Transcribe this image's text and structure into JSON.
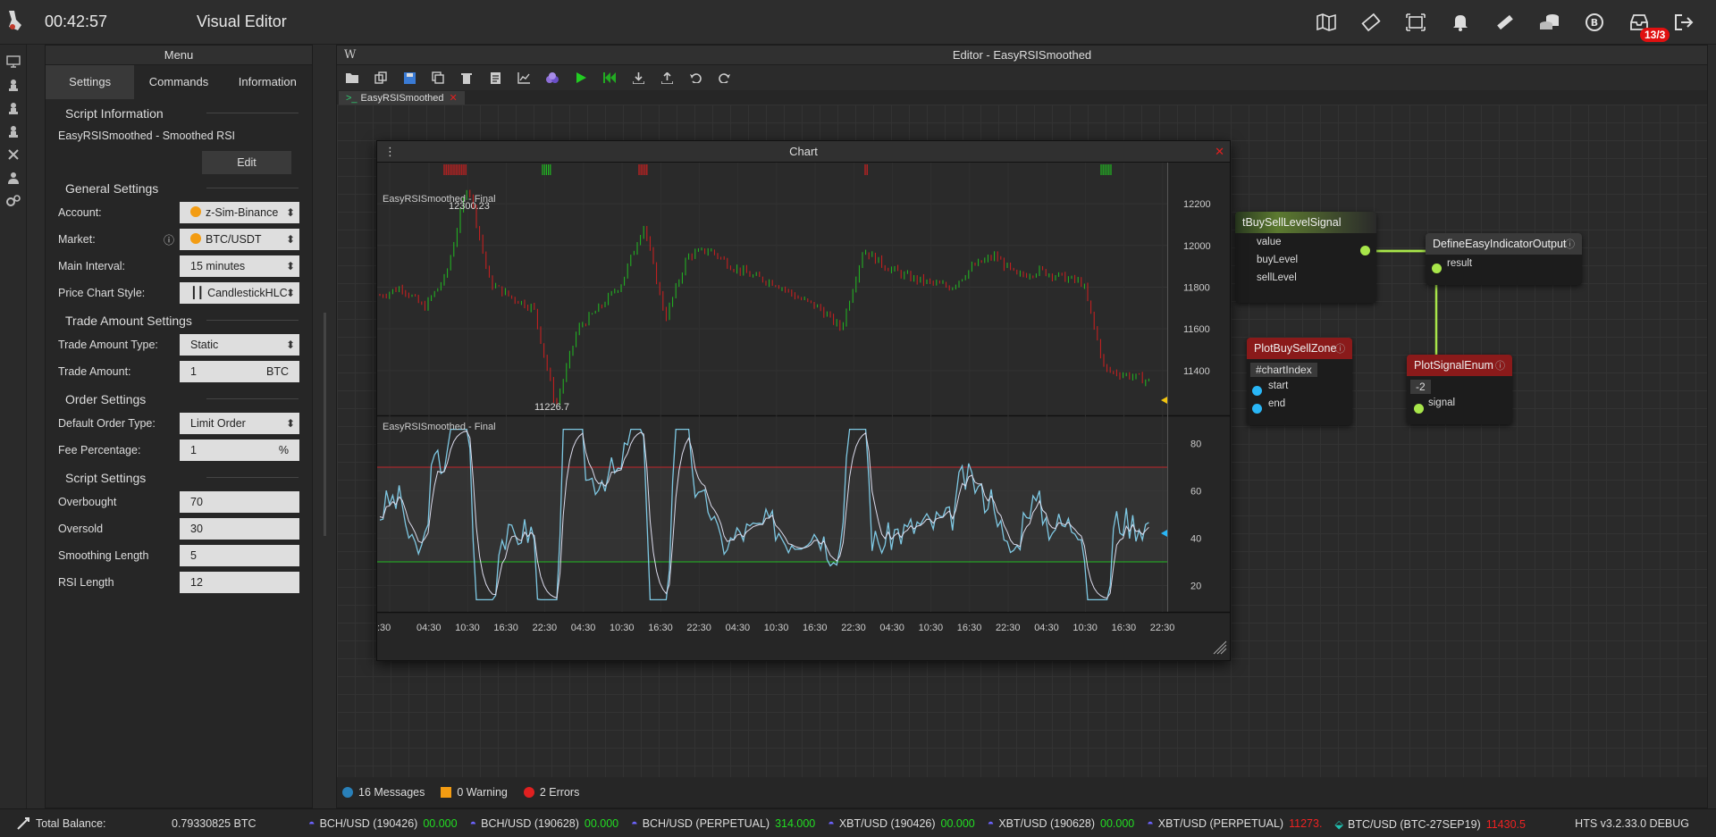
{
  "app": {
    "clock": "00:42:57",
    "title": "Visual Editor",
    "badge": "13/3"
  },
  "top_icons": [
    "map-icon",
    "ticket-icon",
    "scan-icon",
    "bell-icon",
    "ruler-icon",
    "coins-icon",
    "bitcoin-icon",
    "inbox-icon",
    "logout-icon"
  ],
  "left_icons": [
    "monitor-icon",
    "chess-icon",
    "chess-icon",
    "chess-icon",
    "tools-icon",
    "user-icon",
    "gears-icon"
  ],
  "menu": {
    "title": "Menu",
    "tabs": [
      "Settings",
      "Commands",
      "Information"
    ],
    "script_info": {
      "section": "Script Information",
      "text": "EasyRSISmoothed - Smoothed RSI",
      "edit": "Edit"
    },
    "general": {
      "section": "General Settings",
      "account_label": "Account:",
      "account_value": "z-Sim-Binance",
      "market_label": "Market:",
      "market_value": "BTC/USDT",
      "interval_label": "Main Interval:",
      "interval_value": "15 minutes",
      "style_label": "Price Chart Style:",
      "style_value": "CandlestickHLC"
    },
    "trade": {
      "section": "Trade Amount Settings",
      "type_label": "Trade Amount Type:",
      "type_value": "Static",
      "amount_label": "Trade Amount:",
      "amount_value": "1",
      "amount_unit": "BTC"
    },
    "order": {
      "section": "Order Settings",
      "otype_label": "Default Order Type:",
      "otype_value": "Limit Order",
      "fee_label": "Fee Percentage:",
      "fee_value": "1",
      "fee_unit": "%"
    },
    "script": {
      "section": "Script Settings",
      "ob_label": "Overbought",
      "ob_value": "70",
      "os_label": "Oversold",
      "os_value": "30",
      "sl_label": "Smoothing Length",
      "sl_value": "5",
      "rl_label": "RSI Length",
      "rl_value": "12"
    }
  },
  "editor": {
    "title": "Editor - EasyRSISmoothed",
    "logo": "W",
    "file_tab": "EasyRSISmoothed",
    "nodes": {
      "buysell": {
        "title": "tBuySellLevelSignal",
        "ports": [
          "value",
          "buyLevel",
          "sellLevel"
        ]
      },
      "define": {
        "title": "DefineEasyIndicatorOutput",
        "ports": [
          "result"
        ]
      },
      "plotzone": {
        "title": "PlotBuySellZone",
        "param": "#chartIndex",
        "ports": [
          "start",
          "end"
        ]
      },
      "plotsignal": {
        "title": "PlotSignalEnum",
        "param": "-2",
        "ports": [
          "signal"
        ]
      }
    },
    "status": {
      "messages": "16 Messages",
      "warnings": "0 Warning",
      "errors": "2 Errors"
    }
  },
  "chart": {
    "title": "Chart",
    "price_label": "EasyRSISmoothed - Final",
    "rsi_label": "EasyRSISmoothed - Final",
    "price_high_label": "12300.23",
    "price_low_label": "11226.7",
    "price_ticks": [
      "12200",
      "12000",
      "11800",
      "11600",
      "11400"
    ],
    "rsi_ticks": [
      "80",
      "60",
      "40",
      "20"
    ],
    "time_ticks": [
      ":30",
      "04:30",
      "10:30",
      "16:30",
      "22:30",
      "04:30",
      "10:30",
      "16:30",
      "22:30",
      "04:30",
      "10:30",
      "16:30",
      "22:30",
      "04:30",
      "10:30",
      "16:30",
      "22:30",
      "04:30",
      "10:30",
      "16:30",
      "22:30"
    ]
  },
  "chart_data": {
    "type": "line",
    "series": [
      {
        "values": [
          11760,
          11800,
          11700,
          11850,
          12300.23,
          11820,
          11750,
          11700,
          11226.7,
          11600,
          11700,
          11820,
          12100,
          11650,
          11950,
          11980,
          11900,
          11850,
          11820,
          11750,
          11700,
          11600,
          11980,
          11900,
          11850,
          11820,
          11800,
          11900,
          11950,
          11850,
          11880,
          11850,
          11820,
          11400,
          11380,
          11350
        ]
      }
    ],
    "rsi": {
      "overbought": 70,
      "oversold": 30,
      "ylim": [
        10,
        90
      ]
    },
    "ylim": [
      11226.7,
      12300.23
    ]
  },
  "bottom": {
    "balance_label": "Total Balance:",
    "balance_value": "0.79330825 BTC",
    "tickers": [
      {
        "name": "BCH/USD (190426)",
        "value": "00.000",
        "color": "#22dd22"
      },
      {
        "name": "BCH/USD (190628)",
        "value": "00.000",
        "color": "#22dd22"
      },
      {
        "name": "BCH/USD (PERPETUAL)",
        "value": "314.000",
        "color": "#22dd22"
      },
      {
        "name": "XBT/USD (190426)",
        "value": "00.000",
        "color": "#22dd22"
      },
      {
        "name": "XBT/USD (190628)",
        "value": "00.000",
        "color": "#22dd22"
      },
      {
        "name": "XBT/USD (PERPETUAL)",
        "value": "11273.",
        "color": "#ee2222"
      },
      {
        "name": "BTC/USD (BTC-27SEP19)",
        "value": "11430.5",
        "color": "#ee2222"
      }
    ],
    "version": "HTS v3.2.33.0 DEBUG"
  }
}
